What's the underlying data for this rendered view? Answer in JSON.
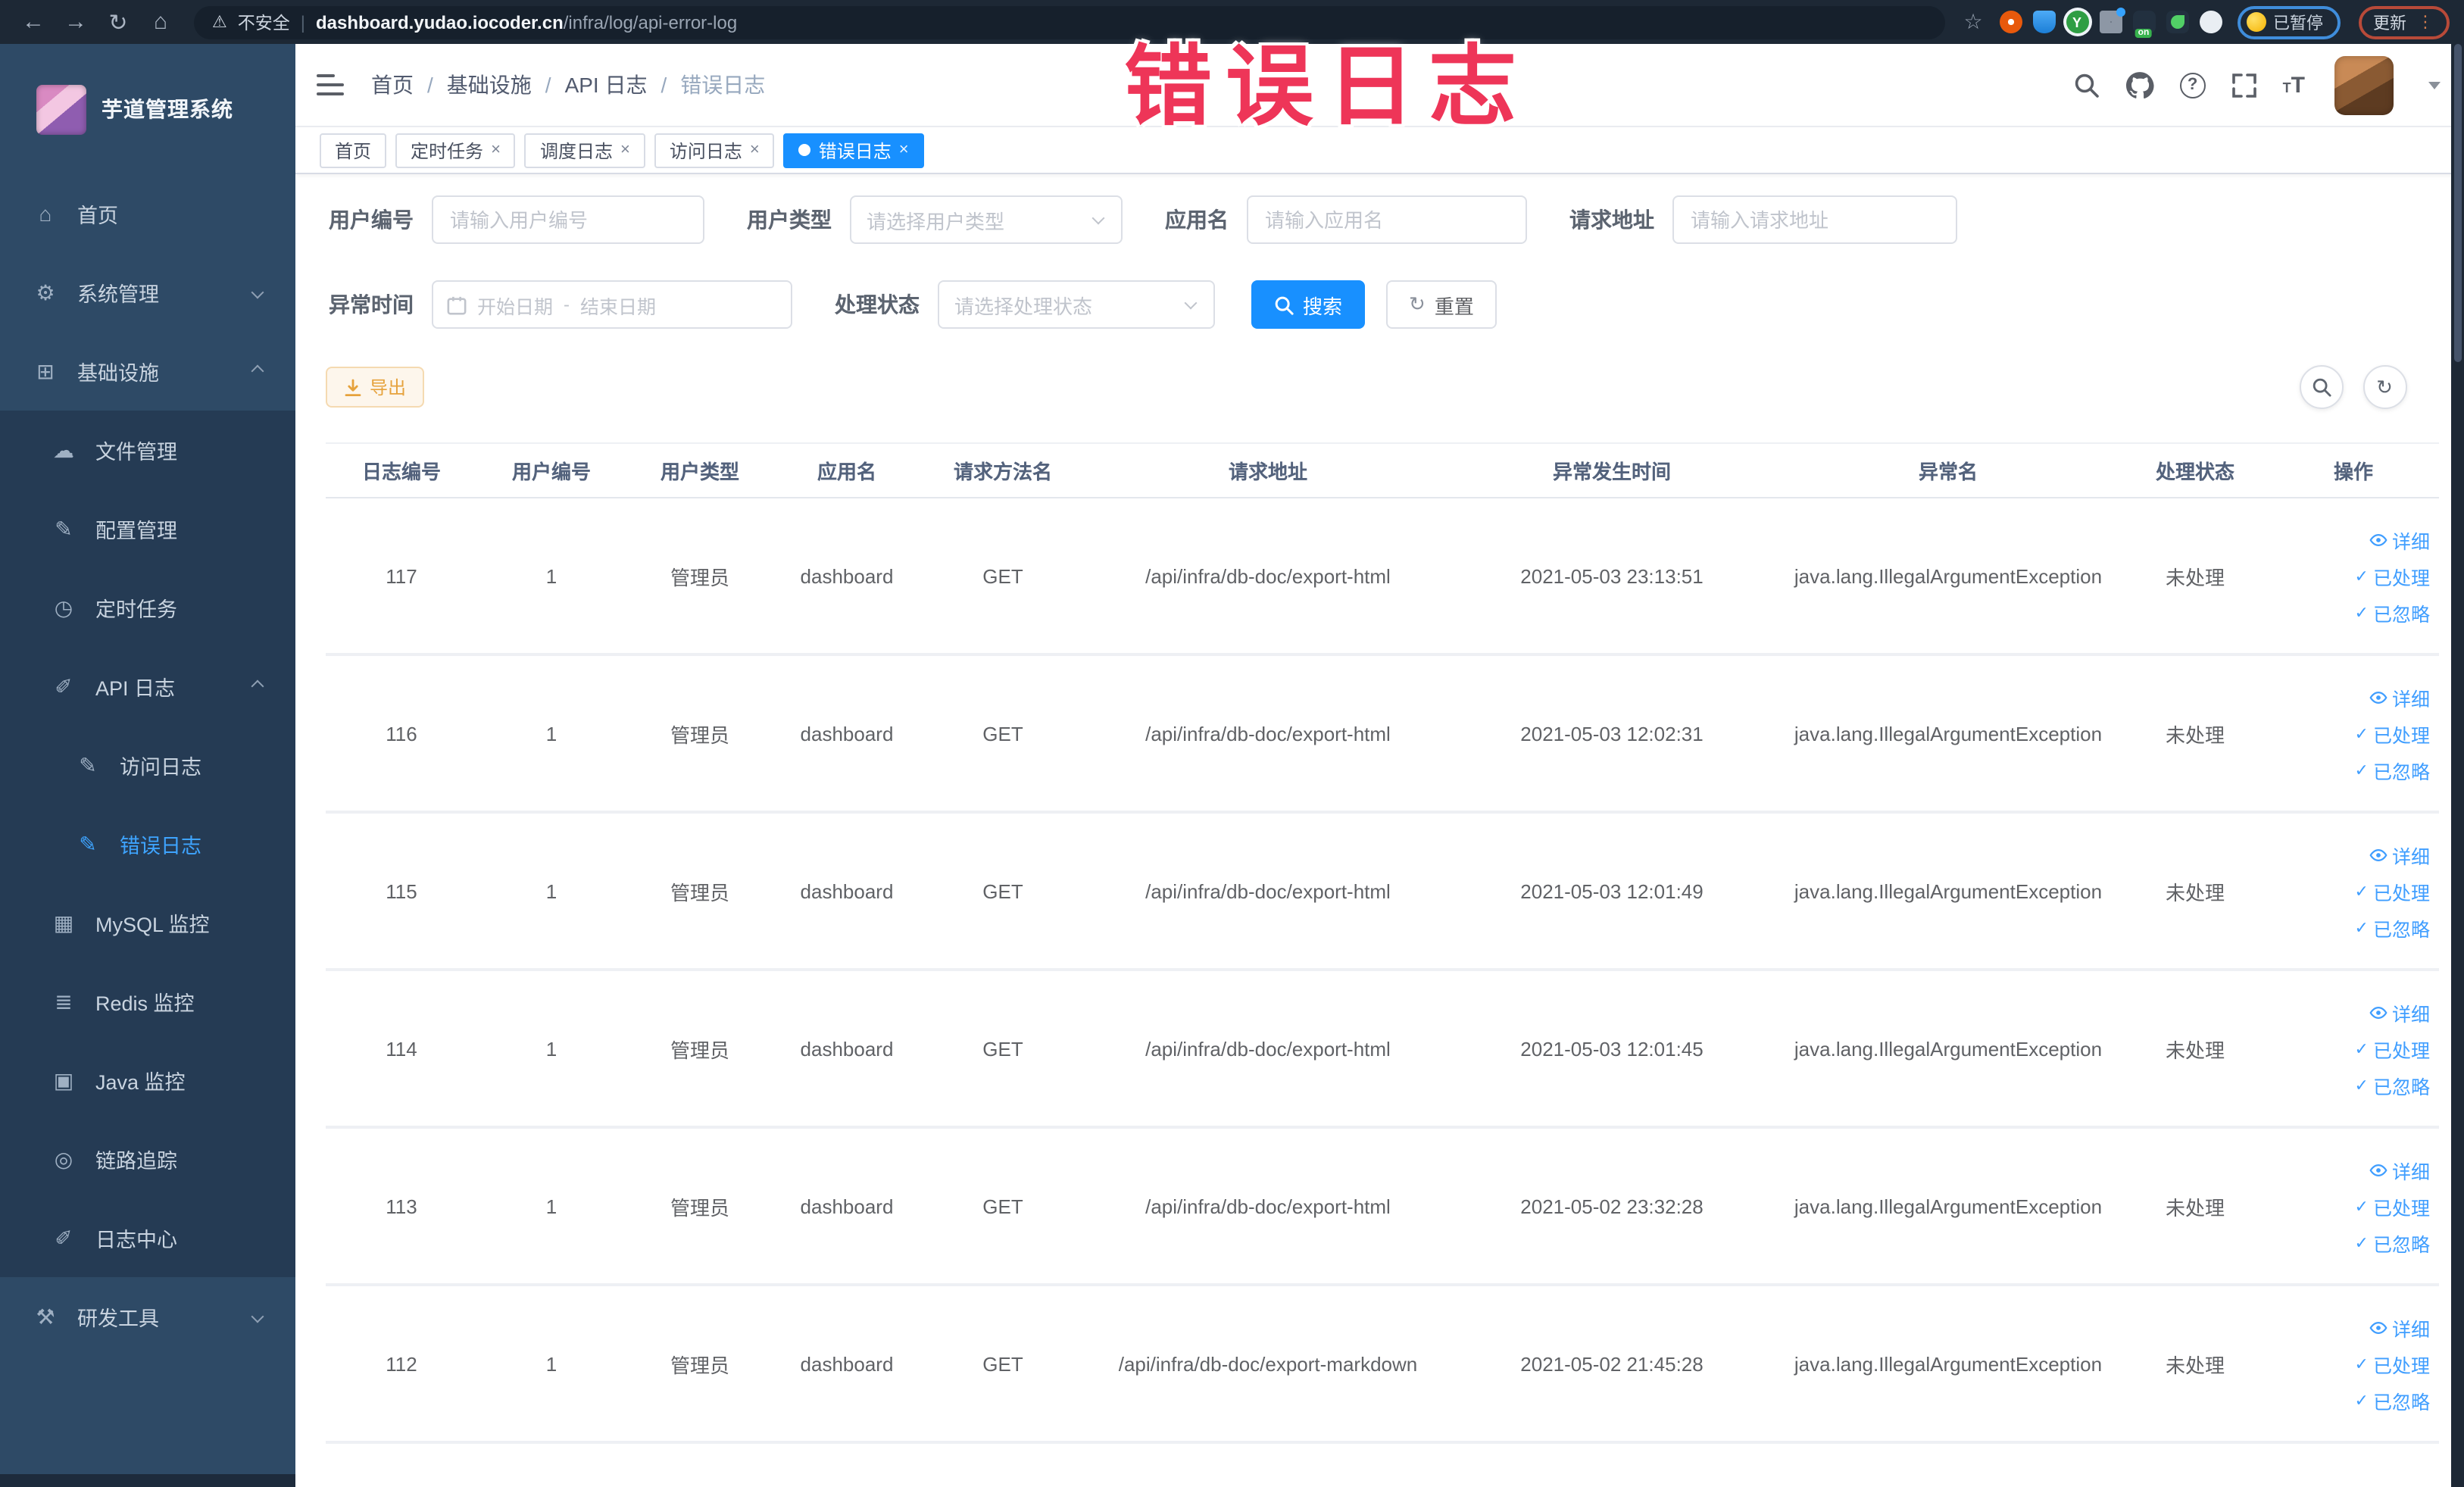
{
  "browser": {
    "insecure_label": "不安全",
    "url_host": "dashboard.yudao.iocoder.cn",
    "url_path": "/infra/log/api-error-log",
    "extension_y_label": "Y",
    "paused_badge": "已暂停",
    "update_button": "更新"
  },
  "annotation": {
    "text": "错误日志"
  },
  "sidebar": {
    "title": "芋道管理系统",
    "items": [
      {
        "label": "首页"
      },
      {
        "label": "系统管理"
      },
      {
        "label": "基础设施"
      },
      {
        "label": "文件管理"
      },
      {
        "label": "配置管理"
      },
      {
        "label": "定时任务"
      },
      {
        "label": "API 日志"
      },
      {
        "label": "访问日志"
      },
      {
        "label": "错误日志"
      },
      {
        "label": "MySQL 监控"
      },
      {
        "label": "Redis 监控"
      },
      {
        "label": "Java 监控"
      },
      {
        "label": "链路追踪"
      },
      {
        "label": "日志中心"
      },
      {
        "label": "研发工具"
      }
    ]
  },
  "header": {
    "breadcrumb": [
      "首页",
      "基础设施",
      "API 日志",
      "错误日志"
    ]
  },
  "tabs": [
    {
      "label": "首页"
    },
    {
      "label": "定时任务"
    },
    {
      "label": "调度日志"
    },
    {
      "label": "访问日志"
    },
    {
      "label": "错误日志"
    }
  ],
  "filters": {
    "user_id_label": "用户编号",
    "user_id_placeholder": "请输入用户编号",
    "user_type_label": "用户类型",
    "user_type_placeholder": "请选择用户类型",
    "app_name_label": "应用名",
    "app_name_placeholder": "请输入应用名",
    "request_url_label": "请求地址",
    "request_url_placeholder": "请输入请求地址",
    "exception_time_label": "异常时间",
    "date_start_placeholder": "开始日期",
    "date_separator": "-",
    "date_end_placeholder": "结束日期",
    "process_status_label": "处理状态",
    "process_status_placeholder": "请选择处理状态",
    "search_button": "搜索",
    "reset_button": "重置"
  },
  "toolbar": {
    "export_button": "导出"
  },
  "table": {
    "columns": [
      "日志编号",
      "用户编号",
      "用户类型",
      "应用名",
      "请求方法名",
      "请求地址",
      "异常发生时间",
      "异常名",
      "处理状态",
      "操作"
    ],
    "actions": [
      "详细",
      "已处理",
      "已忽略"
    ],
    "rows": [
      {
        "id": "117",
        "user_id": "1",
        "user_type": "管理员",
        "app": "dashboard",
        "method": "GET",
        "url": "/api/infra/db-doc/export-html",
        "time": "2021-05-03 23:13:51",
        "exception": "java.lang.IllegalArgumentException",
        "status": "未处理"
      },
      {
        "id": "116",
        "user_id": "1",
        "user_type": "管理员",
        "app": "dashboard",
        "method": "GET",
        "url": "/api/infra/db-doc/export-html",
        "time": "2021-05-03 12:02:31",
        "exception": "java.lang.IllegalArgumentException",
        "status": "未处理"
      },
      {
        "id": "115",
        "user_id": "1",
        "user_type": "管理员",
        "app": "dashboard",
        "method": "GET",
        "url": "/api/infra/db-doc/export-html",
        "time": "2021-05-03 12:01:49",
        "exception": "java.lang.IllegalArgumentException",
        "status": "未处理"
      },
      {
        "id": "114",
        "user_id": "1",
        "user_type": "管理员",
        "app": "dashboard",
        "method": "GET",
        "url": "/api/infra/db-doc/export-html",
        "time": "2021-05-03 12:01:45",
        "exception": "java.lang.IllegalArgumentException",
        "status": "未处理"
      },
      {
        "id": "113",
        "user_id": "1",
        "user_type": "管理员",
        "app": "dashboard",
        "method": "GET",
        "url": "/api/infra/db-doc/export-html",
        "time": "2021-05-02 23:32:28",
        "exception": "java.lang.IllegalArgumentException",
        "status": "未处理"
      },
      {
        "id": "112",
        "user_id": "1",
        "user_type": "管理员",
        "app": "dashboard",
        "method": "GET",
        "url": "/api/infra/db-doc/export-markdown",
        "time": "2021-05-02 21:45:28",
        "exception": "java.lang.IllegalArgumentException",
        "status": "未处理"
      }
    ]
  },
  "colors": {
    "accent": "#1890ff",
    "link": "#409eff",
    "warning": "#e6a23c",
    "annotation": "#ee3558",
    "sidebar_bg": "#2e4a66",
    "submenu_bg": "#253b54",
    "toolbar_bg": "#1d2835"
  }
}
